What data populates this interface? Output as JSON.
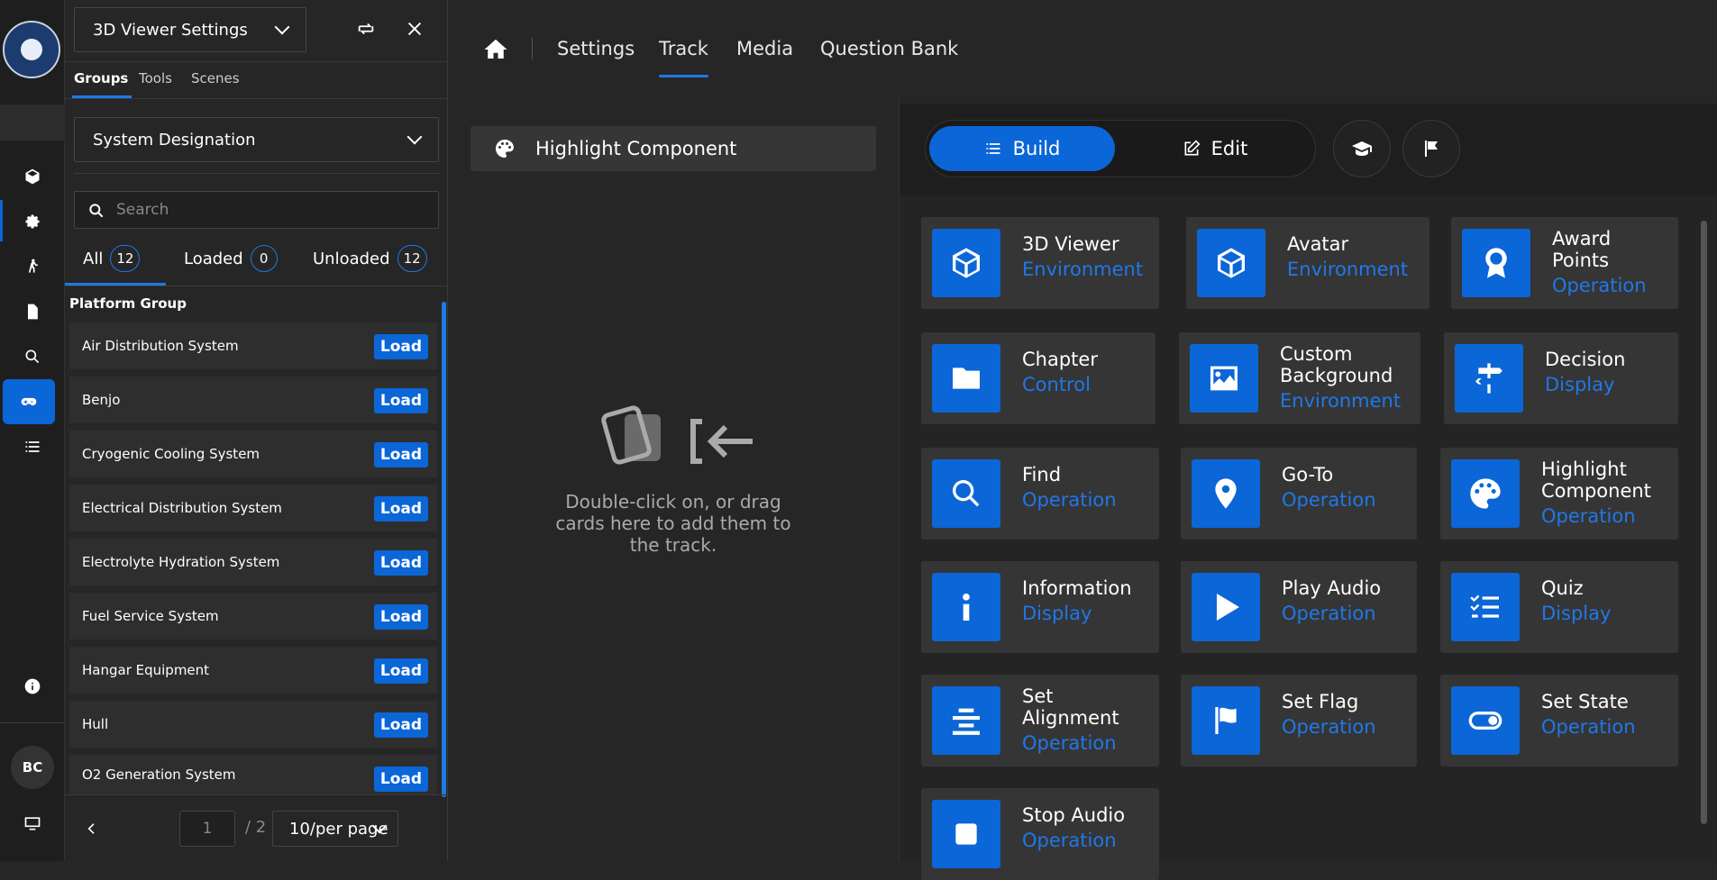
{
  "colors": {
    "accent": "#0b66d8",
    "link": "#1f78e8",
    "bg": "#262626"
  },
  "rail": {
    "icons": [
      "cube-icon",
      "gear-icon",
      "walk-icon",
      "document-icon",
      "search-icon",
      "gamepad-icon",
      "list-icon",
      "info-icon",
      "monitor-icon"
    ],
    "avatar": "BC"
  },
  "panel": {
    "title": "3D Viewer Settings",
    "tabs": [
      "Groups",
      "Tools",
      "Scenes"
    ],
    "group_select": "System Designation",
    "search_placeholder": "Search",
    "filters": [
      {
        "label": "All",
        "count": "12"
      },
      {
        "label": "Loaded",
        "count": "0"
      },
      {
        "label": "Unloaded",
        "count": "12"
      }
    ],
    "group_title": "Platform Group",
    "rows": [
      {
        "name": "Air Distribution System",
        "action": "Load"
      },
      {
        "name": "Benjo",
        "action": "Load"
      },
      {
        "name": "Cryogenic Cooling System",
        "action": "Load"
      },
      {
        "name": "Electrical Distribution System",
        "action": "Load"
      },
      {
        "name": "Electrolyte Hydration System",
        "action": "Load"
      },
      {
        "name": "Fuel Service System",
        "action": "Load"
      },
      {
        "name": "Hangar Equipment",
        "action": "Load"
      },
      {
        "name": "Hull",
        "action": "Load"
      },
      {
        "name": "O2 Generation System",
        "action": "Load"
      }
    ],
    "pager": {
      "page": "1",
      "total": "/ 2",
      "per_page": "10/per page"
    }
  },
  "nav": {
    "items": [
      "Settings",
      "Track",
      "Media",
      "Question Bank"
    ],
    "active": "Track"
  },
  "track": {
    "card": "Highlight Component",
    "empty_message": "Double-click on, or drag cards here to add them to the track."
  },
  "library": {
    "modes": [
      "Build",
      "Edit"
    ],
    "cards": [
      {
        "title": [
          "3D Viewer"
        ],
        "category": "Environment",
        "icon": "cube-icon"
      },
      {
        "title": [
          "Avatar"
        ],
        "category": "Environment",
        "icon": "cube-icon"
      },
      {
        "title": [
          "Award",
          "Points"
        ],
        "category": "Operation",
        "icon": "award-icon"
      },
      {
        "title": [
          "Chapter"
        ],
        "category": "Control",
        "icon": "folder-icon"
      },
      {
        "title": [
          "Custom",
          "Background"
        ],
        "category": "Environment",
        "icon": "image-icon"
      },
      {
        "title": [
          "Decision"
        ],
        "category": "Display",
        "icon": "signpost-icon"
      },
      {
        "title": [
          "Find"
        ],
        "category": "Operation",
        "icon": "search-icon"
      },
      {
        "title": [
          "Go-To"
        ],
        "category": "Operation",
        "icon": "map-pin-icon"
      },
      {
        "title": [
          "Highlight",
          "Component"
        ],
        "category": "Operation",
        "icon": "palette-icon"
      },
      {
        "title": [
          "Information"
        ],
        "category": "Display",
        "icon": "info-icon"
      },
      {
        "title": [
          "Play Audio"
        ],
        "category": "Operation",
        "icon": "play-icon"
      },
      {
        "title": [
          "Quiz"
        ],
        "category": "Display",
        "icon": "checklist-icon"
      },
      {
        "title": [
          "Set",
          "Alignment"
        ],
        "category": "Operation",
        "icon": "align-center-icon"
      },
      {
        "title": [
          "Set Flag"
        ],
        "category": "Operation",
        "icon": "flag-icon"
      },
      {
        "title": [
          "Set State"
        ],
        "category": "Operation",
        "icon": "toggle-icon"
      },
      {
        "title": [
          "Stop Audio"
        ],
        "category": "Operation",
        "icon": "stop-icon"
      }
    ]
  }
}
